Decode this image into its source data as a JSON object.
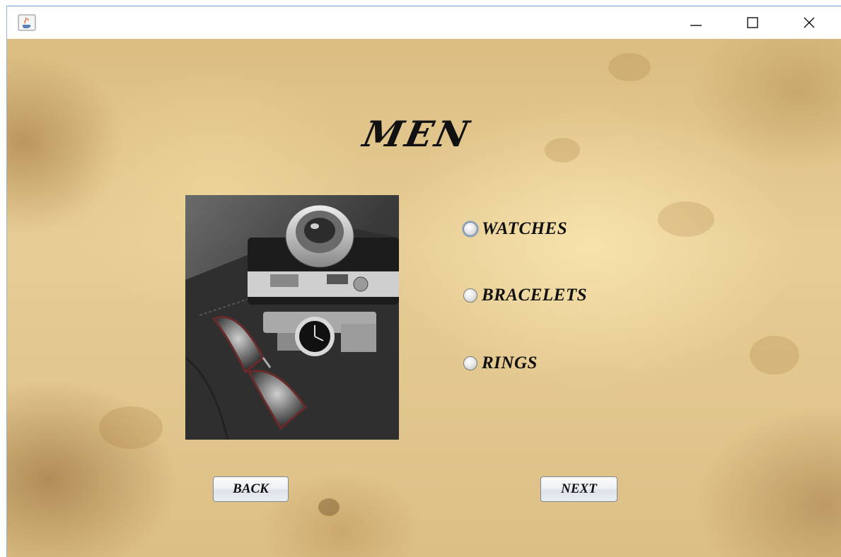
{
  "window": {
    "title": "",
    "icon": "java-coffee-icon",
    "controls": [
      "minimize-icon",
      "maximize-icon",
      "close-icon"
    ]
  },
  "page": {
    "heading": "MEN",
    "image": "camera-watch-sunglasses-photo"
  },
  "options": [
    {
      "label": "WATCHES",
      "selected": false
    },
    {
      "label": "BRACELETS",
      "selected": false
    },
    {
      "label": "RINGS",
      "selected": false
    }
  ],
  "buttons": {
    "back_label": "BACK",
    "next_label": "NEXT"
  },
  "colors": {
    "parchment": "#e2c78e",
    "text": "#111111",
    "accent": "#3c78c8"
  }
}
